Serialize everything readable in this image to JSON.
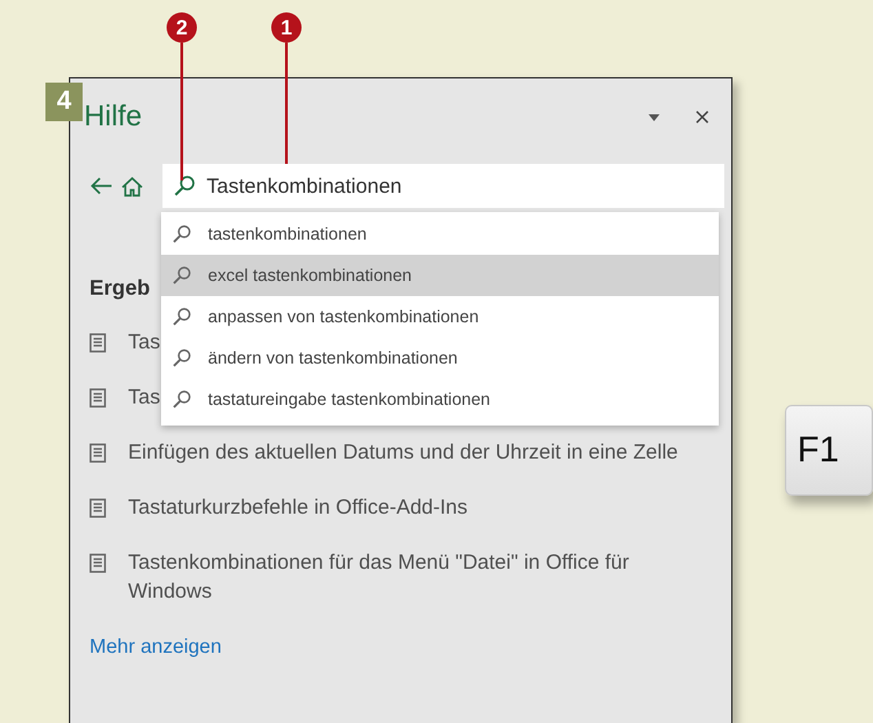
{
  "step": "4",
  "callouts": [
    {
      "label": "2"
    },
    {
      "label": "1"
    }
  ],
  "help_pane": {
    "title": "Hilfe",
    "search": {
      "value": "Tastenkombinationen"
    },
    "suggestions": [
      {
        "text": "tastenkombinationen",
        "selected": false
      },
      {
        "text": "excel tastenkombinationen",
        "selected": true
      },
      {
        "text": "anpassen von tastenkombinationen",
        "selected": false
      },
      {
        "text": "ändern von tastenkombinationen",
        "selected": false
      },
      {
        "text": "tastatureingabe tastenkombinationen",
        "selected": false
      }
    ],
    "results_heading": "Ergeb",
    "results": [
      "Tas",
      "Tas",
      "Einfügen des aktuellen Datums und der Uhrzeit in eine Zelle",
      "Tastaturkurzbefehle in Office-Add-Ins",
      "Tastenkombinationen für das Menü \"Datei\" in Office für Windows"
    ],
    "more_link": "Mehr anzeigen"
  },
  "key": "F1"
}
